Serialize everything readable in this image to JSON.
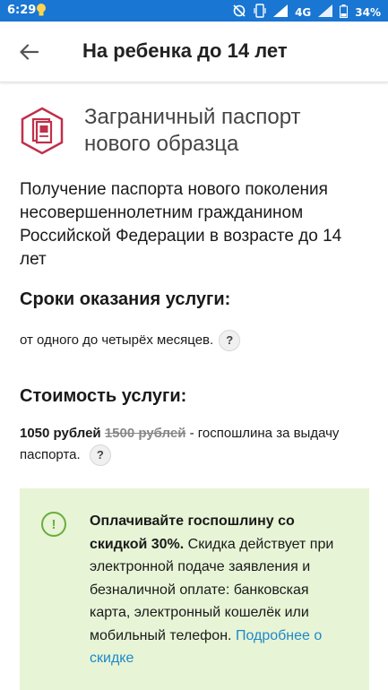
{
  "status_bar": {
    "time": "6:29",
    "network": "4G",
    "battery": "34%"
  },
  "app_bar": {
    "title": "На ребенка до 14 лет"
  },
  "service": {
    "icon": "passport-icon",
    "title": "Заграничный паспорт нового образца",
    "description": "Получение паспорта нового поколения несовершеннолетним гражданином Российской Федерации в возрасте до 14 лет"
  },
  "terms": {
    "heading": "Сроки оказания услуги:",
    "text": "от одного до четырёх месяцев."
  },
  "cost": {
    "heading": "Стоимость услуги:",
    "price": "1050 рублей",
    "old_price": "1500 рублей",
    "text": " - госпошлина за выдачу паспорта."
  },
  "promo": {
    "bold": "Оплачивайте госпошлину со скидкой 30%.",
    "text": " Скидка действует при электронной подаче заявления и безналичной оплате: банковская карта, электронный кошелёк или мобильный телефон. ",
    "link": "Подробнее о скидке"
  },
  "help_label": "?",
  "colors": {
    "accent": "#c0304a",
    "link": "#1e88c9",
    "promo_bg": "#e7f4d6",
    "promo_icon": "#6aae3a",
    "status_bar": "#1976d2"
  }
}
